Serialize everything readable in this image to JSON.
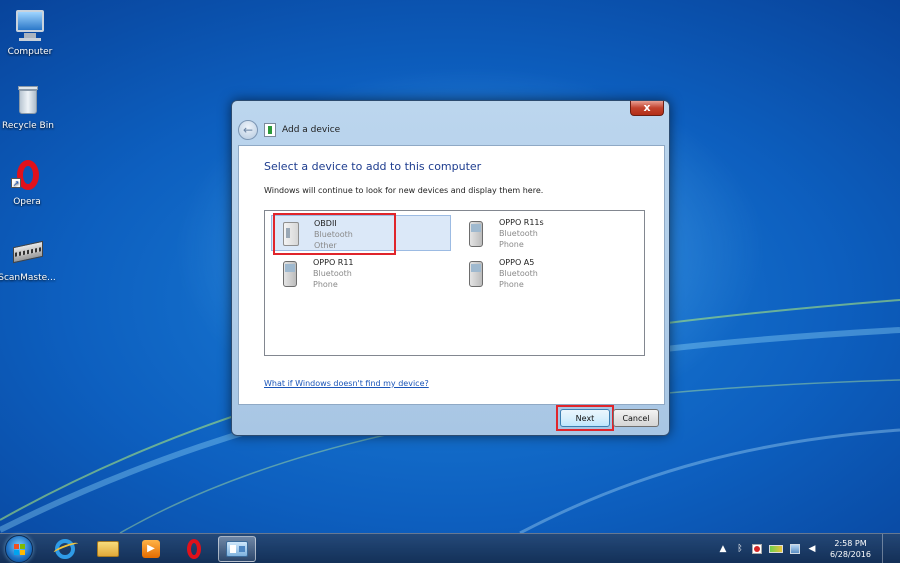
{
  "desktop": {
    "icons": [
      {
        "label": "Computer",
        "icon": "computer-icon"
      },
      {
        "label": "Recycle Bin",
        "icon": "recycle-bin-icon"
      },
      {
        "label": "Opera",
        "icon": "opera-icon"
      },
      {
        "label": "ScanMaste...",
        "icon": "scanmaster-icon"
      }
    ]
  },
  "dialog": {
    "title": "Add a device",
    "close_label": "x",
    "heading": "Select a device to add to this computer",
    "subtext": "Windows will continue to look for new devices and display them here.",
    "devices": [
      {
        "name": "OBDII",
        "type": "Bluetooth",
        "category": "Other",
        "icon": "obd-device-icon",
        "selected": true
      },
      {
        "name": "OPPO R11s",
        "type": "Bluetooth",
        "category": "Phone",
        "icon": "phone-icon",
        "selected": false
      },
      {
        "name": "OPPO R11",
        "type": "Bluetooth",
        "category": "Phone",
        "icon": "phone-icon",
        "selected": false
      },
      {
        "name": "OPPO A5",
        "type": "Bluetooth",
        "category": "Phone",
        "icon": "phone-icon",
        "selected": false
      }
    ],
    "help_link": "What if Windows doesn't find my device?",
    "next_label": "Next",
    "cancel_label": "Cancel",
    "highlight_color": "#e0252b"
  },
  "taskbar": {
    "pinned": [
      "internet-explorer-icon",
      "file-explorer-icon",
      "media-player-icon",
      "opera-icon",
      "devices-icon"
    ],
    "tray": {
      "overflow": "▲",
      "bluetooth": "ᛒ",
      "volume": "◀"
    },
    "clock": {
      "time": "2:58 PM",
      "date": "6/28/2016"
    }
  }
}
